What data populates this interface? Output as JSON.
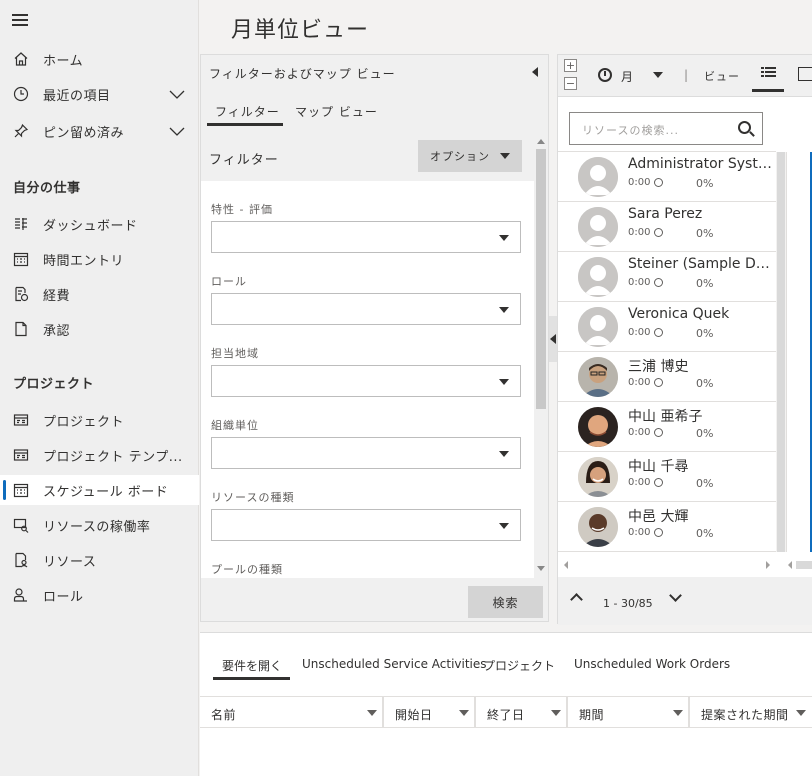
{
  "page": {
    "title": "月単位ビュー"
  },
  "sidebar": {
    "items_top": [
      {
        "label": "ホーム",
        "icon": "home-icon"
      },
      {
        "label": "最近の項目",
        "icon": "clock-icon"
      },
      {
        "label": "ピン留め済み",
        "icon": "pin-icon"
      }
    ],
    "section_my_work": "自分の仕事",
    "my_work": [
      {
        "label": "ダッシュボード",
        "icon": "dashboard-icon"
      },
      {
        "label": "時間エントリ",
        "icon": "calendar-icon"
      },
      {
        "label": "経費",
        "icon": "expense-icon"
      },
      {
        "label": "承認",
        "icon": "approval-icon"
      }
    ],
    "section_projects": "プロジェクト",
    "projects": [
      {
        "label": "プロジェクト",
        "icon": "project-icon"
      },
      {
        "label": "プロジェクト テンプ...",
        "icon": "project-template-icon"
      },
      {
        "label": "スケジュール ボード",
        "icon": "schedule-board-icon",
        "active": true
      },
      {
        "label": "リソースの稼働率",
        "icon": "resource-utilization-icon"
      },
      {
        "label": "リソース",
        "icon": "resource-icon"
      },
      {
        "label": "ロール",
        "icon": "role-icon"
      }
    ]
  },
  "filter_panel": {
    "header": "フィルターおよびマップ ビュー",
    "tabs": [
      "フィルター",
      "マップ ビュー"
    ],
    "filter_label": "フィルター",
    "options_label": "オプション",
    "fields": [
      "特性 - 評価",
      "ロール",
      "担当地域",
      "組織単位",
      "リソースの種類",
      "プールの種類"
    ],
    "search_button": "検索"
  },
  "board": {
    "toolbar": {
      "month": "月",
      "separator": "|",
      "view": "ビュー"
    },
    "search_placeholder": "リソースの検索...",
    "resources": [
      {
        "name": "Administrator System",
        "hours": "0:00",
        "pct": "0%"
      },
      {
        "name": "Sara Perez",
        "hours": "0:00",
        "pct": "0%"
      },
      {
        "name": "Steiner (Sample Dat...",
        "hours": "0:00",
        "pct": "0%"
      },
      {
        "name": "Veronica Quek",
        "hours": "0:00",
        "pct": "0%"
      },
      {
        "name": "三浦 博史",
        "hours": "0:00",
        "pct": "0%"
      },
      {
        "name": "中山 亜希子",
        "hours": "0:00",
        "pct": "0%"
      },
      {
        "name": "中山 千尋",
        "hours": "0:00",
        "pct": "0%"
      },
      {
        "name": "中邑 大輝",
        "hours": "0:00",
        "pct": "0%"
      }
    ],
    "pager": "1 - 30/85"
  },
  "bottom": {
    "tabs": [
      "要件を開く",
      "Unscheduled Service Activities",
      "プロジェクト",
      "Unscheduled Work Orders"
    ],
    "columns": [
      "名前",
      "開始日",
      "終了日",
      "期間",
      "提案された期間"
    ]
  },
  "colors": {
    "accent": "#0f6cbd",
    "sidebar_bg": "#efefef"
  }
}
